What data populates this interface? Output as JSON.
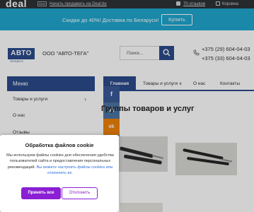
{
  "topbar": {
    "logo": "deal",
    "sell_badge": "NEW",
    "sell_link": "Начать продавать на Deal.by",
    "reviews": "70 отзывов",
    "cart": "Корзина"
  },
  "promo": {
    "text": "Скидки до 40%! Доставка по Беларуси!",
    "button": "Купить"
  },
  "header": {
    "logo_main": "АВТО",
    "logo_sub": "ПРАВОЗ",
    "company": "ООО \"АВТО-ТЕГА\"",
    "search_placeholder": "Поиск...",
    "phone1": "+375 (29) 604-04-03",
    "phone2": "+375 (33) 604-04-03"
  },
  "nav": {
    "main": "Главная",
    "products": "Товары и услуги",
    "about": "О нас",
    "contacts": "Контакты"
  },
  "sidebar": {
    "heading": "Меню",
    "items": [
      {
        "label": "Товары и услуги"
      },
      {
        "label": "О нас"
      },
      {
        "label": "Отзывы"
      }
    ]
  },
  "social": [
    {
      "glyph": "f",
      "color": "#3b5998",
      "icon": "facebook-icon"
    },
    {
      "glyph": "vk",
      "color": "#4c75a3",
      "icon": "vk-icon"
    },
    {
      "glyph": "ok",
      "color": "#ee8208",
      "icon": "odnoklassniki-icon"
    },
    {
      "glyph": "✉",
      "color": "#168de2",
      "icon": "mail-icon"
    }
  ],
  "main": {
    "section_title": "Группы товаров и услуг"
  },
  "cookie": {
    "title": "Обработка файлов cookie",
    "body": "Мы используем файлы cookies для обеспечения удобства пользователей сайта и предоставления персональных рекомендаций.",
    "link": "Вы можете настроить файлы cookies или отключить их.",
    "accept": "Принять все",
    "reject": "Отклонить"
  },
  "colors": {
    "brand": "#2b4b8c",
    "promo": "#1fa6cf",
    "accent": "#8a1fd3"
  }
}
